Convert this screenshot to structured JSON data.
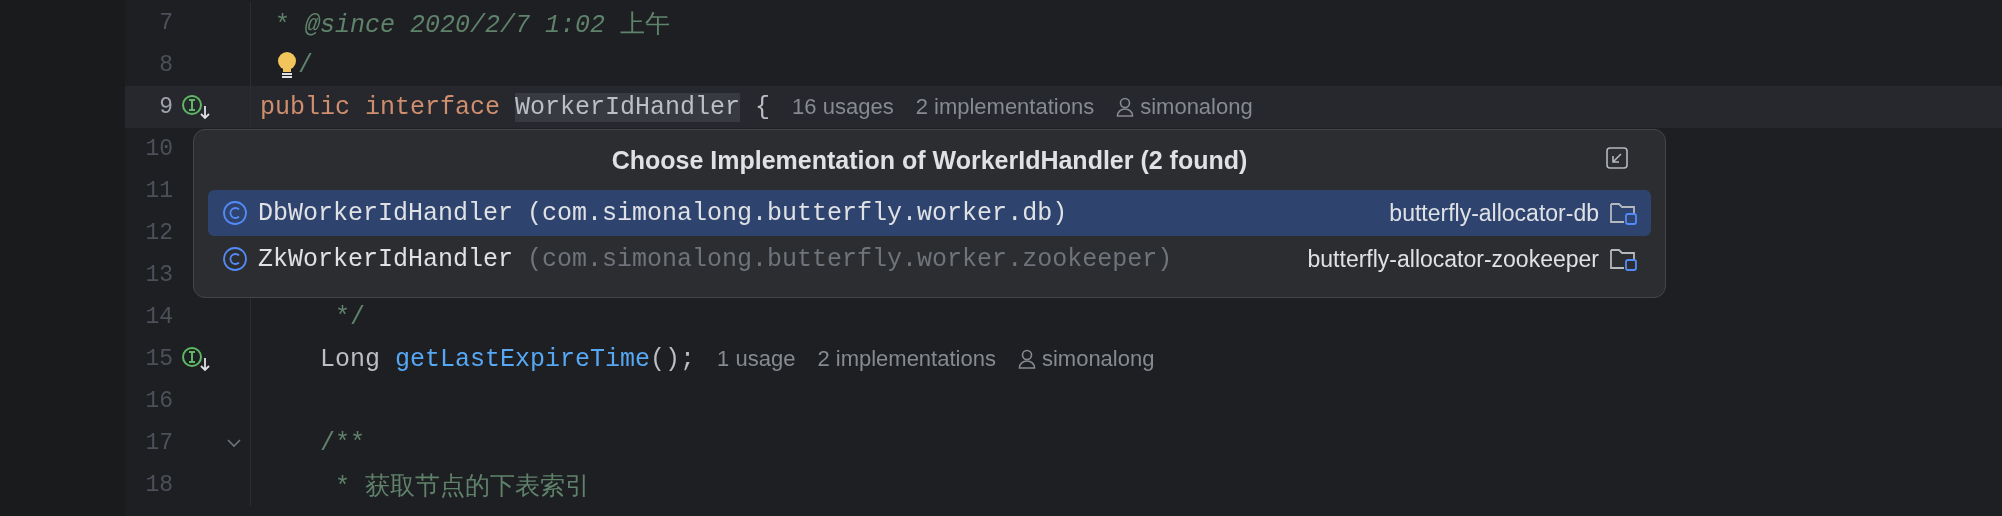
{
  "editor": {
    "lines": [
      {
        "number": "7",
        "current": false,
        "implemented": false,
        "foldable": false,
        "tokens": [
          {
            "kind": "comment",
            "text": " * "
          },
          {
            "kind": "doc-tag",
            "text": "@since"
          },
          {
            "kind": "comment-italic",
            "text": " 2020/2/7 1:02 "
          },
          {
            "kind": "comment",
            "text": "上午"
          }
        ]
      },
      {
        "number": "8",
        "current": false,
        "implemented": false,
        "foldable": false,
        "bulb": true,
        "tokens": [
          {
            "kind": "comment",
            "text": "/"
          }
        ]
      },
      {
        "number": "9",
        "current": true,
        "implemented": true,
        "foldable": false,
        "tokens": [
          {
            "kind": "keyword",
            "text": "public interface "
          },
          {
            "kind": "highlighted",
            "text": "WorkerIdHandler"
          },
          {
            "kind": "plain",
            "text": " {"
          }
        ],
        "hints": [
          {
            "kind": "usage",
            "text": "16 usages"
          },
          {
            "kind": "usage",
            "text": "2 implementations"
          },
          {
            "kind": "author",
            "text": "simonalong"
          }
        ]
      },
      {
        "number": "10",
        "current": false,
        "implemented": false,
        "foldable": false
      },
      {
        "number": "11",
        "current": false,
        "implemented": false,
        "foldable": false
      },
      {
        "number": "12",
        "current": false,
        "implemented": false,
        "foldable": false
      },
      {
        "number": "13",
        "current": false,
        "implemented": false,
        "foldable": false
      },
      {
        "number": "14",
        "current": false,
        "implemented": false,
        "foldable": false,
        "tokens": [
          {
            "kind": "comment",
            "text": "     */"
          }
        ]
      },
      {
        "number": "15",
        "current": false,
        "implemented": true,
        "foldable": false,
        "tokens": [
          {
            "kind": "plain",
            "text": "    Long "
          },
          {
            "kind": "method",
            "text": "getLastExpireTime"
          },
          {
            "kind": "plain",
            "text": "();"
          }
        ],
        "hints": [
          {
            "kind": "usage",
            "text": "1 usage"
          },
          {
            "kind": "usage",
            "text": "2 implementations"
          },
          {
            "kind": "author",
            "text": "simonalong"
          }
        ]
      },
      {
        "number": "16",
        "current": false,
        "implemented": false,
        "foldable": false
      },
      {
        "number": "17",
        "current": false,
        "implemented": false,
        "foldable": true,
        "tokens": [
          {
            "kind": "comment",
            "text": "    /**"
          }
        ]
      },
      {
        "number": "18",
        "current": false,
        "implemented": false,
        "foldable": false,
        "tokens": [
          {
            "kind": "comment",
            "text": "     * 获取节点的下表索引"
          }
        ]
      }
    ]
  },
  "popup": {
    "title": "Choose Implementation of WorkerIdHandler (2 found)",
    "items": [
      {
        "name": "DbWorkerIdHandler",
        "package": "(com.simonalong.butterfly.worker.db)",
        "module": "butterfly-allocator-db",
        "selected": true
      },
      {
        "name": "ZkWorkerIdHandler",
        "package": "(com.simonalong.butterfly.worker.zookeeper)",
        "module": "butterfly-allocator-zookeeper",
        "selected": false
      }
    ]
  }
}
